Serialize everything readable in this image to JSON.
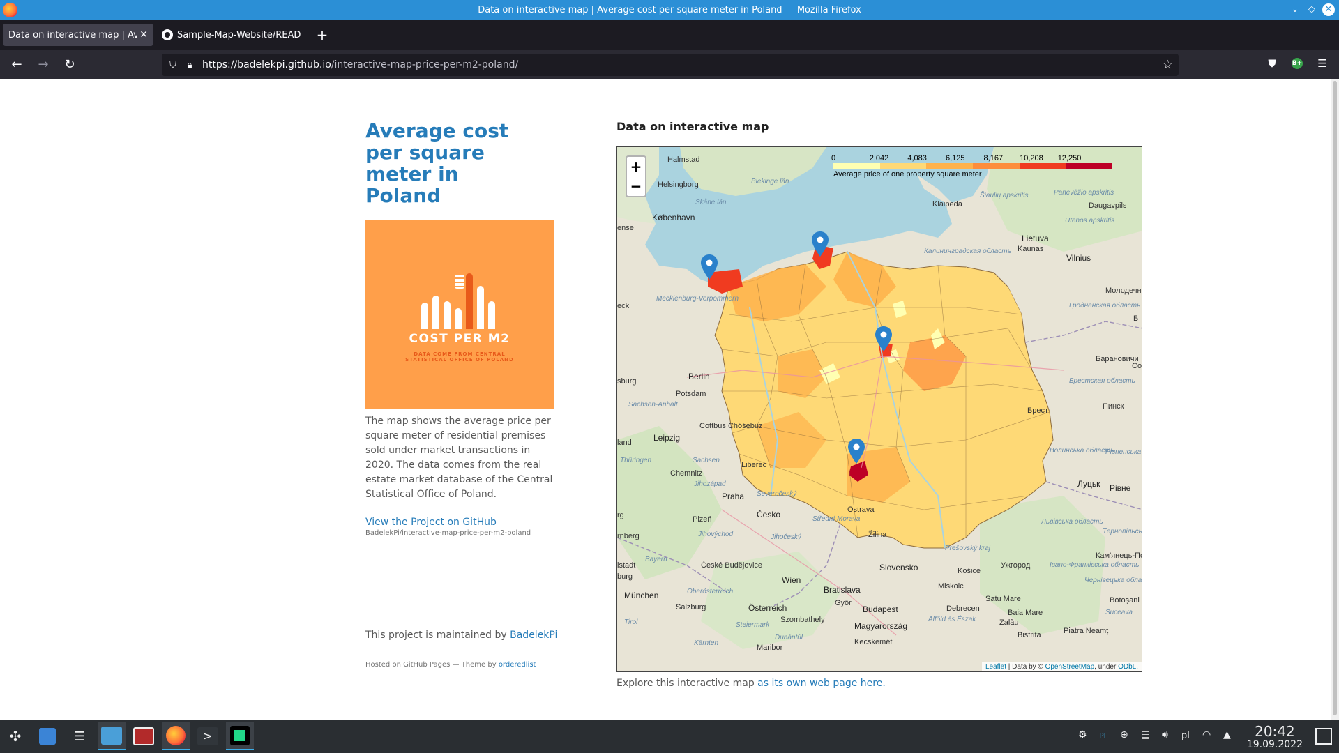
{
  "window": {
    "title": "Data on interactive map | Average cost per square meter in Poland — Mozilla Firefox",
    "controls": [
      "minimize-icon",
      "maximize-icon",
      "close-icon"
    ]
  },
  "tabs": [
    {
      "label": "Data on interactive map | Average cost per square meter in Poland",
      "active": true
    },
    {
      "label": "Sample-Map-Website/README.md",
      "active": false
    }
  ],
  "urlbar": {
    "host": "https://badelekpi.github.io",
    "path": "/interactive-map-price-per-m2-poland/"
  },
  "extension_badge": "B+",
  "sidebar": {
    "title": "Average cost per square meter in Poland",
    "logo_title": "COST PER M2",
    "logo_sub_1": "DATA COME FROM CENTRAL",
    "logo_sub_2": "STATISTICAL OFFICE OF POLAND",
    "description": "The map shows the average price per square meter of residential premises sold under market transactions in 2020. The data comes from the real estate market database of the Central Statistical Office of Poland.",
    "github_link": "View the Project on GitHub",
    "github_repo": "BadelekPi/interactive-map-price-per-m2-poland",
    "maintained_prefix": "This project is maintained by ",
    "maintainer": "BadelekPi",
    "hosted_prefix": "Hosted on GitHub Pages — Theme by ",
    "theme": "orderedlist"
  },
  "map": {
    "heading": "Data on interactive map",
    "zoom_in": "+",
    "zoom_out": "−",
    "legend": {
      "ticks": [
        "0",
        "2,042",
        "4,083",
        "6,125",
        "8,167",
        "10,208",
        "12,250"
      ],
      "colors": [
        "#ffffb2",
        "#fed976",
        "#feb24c",
        "#fd8d3c",
        "#f03b20",
        "#bd0026"
      ],
      "caption": "Average price of one property square meter"
    },
    "attribution": {
      "leaflet": "Leaflet",
      "mid": " | Data by © ",
      "osm": "OpenStreetMap",
      "under": ", under ",
      "odbl": "ODbL."
    },
    "labels": {
      "halmstad": "Halmstad",
      "helsingborg": "Helsingborg",
      "kobenhavn": "København",
      "skane": "Skåne län",
      "blekinge": "Blekinge län",
      "klaipeda": "Klaipėda",
      "siauliu": "Šiaulių apskritis",
      "panevezio": "Panevėžio apskritis",
      "daugavpils": "Daugavpils",
      "utenos": "Utenos apskritis",
      "lietuva": "Lietuva",
      "kaunas": "Kaunas",
      "vilnius": "Vilnius",
      "kaliningrad": "Калининградская область",
      "molodechno": "Молодечно",
      "grodno": "Гродненская область",
      "baranovichi": "Барановичи",
      "brest_obl": "Брестская область",
      "brest": "Брест",
      "pinsk": "Пинск",
      "mecklenburg": "Mecklenburg-Vorpommern",
      "berlin": "Berlin",
      "potsdam": "Potsdam",
      "sachsen_anhalt": "Sachsen-Anhalt",
      "cottbus": "Cottbus Chóśebuz",
      "leipzig": "Leipzig",
      "thuringen": "Thüringen",
      "sachsen": "Sachsen",
      "chemnitz": "Chemnitz",
      "liberec": "Liberec",
      "praha": "Praha",
      "cesko": "Česko",
      "plzen": "Plzeň",
      "severocesky": "Severočeský",
      "strední_morava": "Střední Morava",
      "jihocesky": "Jihočeský",
      "plzensky": "Jihozápad",
      "jihovychod": "Jihovýchod",
      "ceske_budejovice": "České Budějovice",
      "ostrava": "Ostrava",
      "zilina": "Žilina",
      "slovensko": "Slovensko",
      "presovsky": "Prešovský kraj",
      "kosice": "Košice",
      "miskolc": "Miskolc",
      "uzhgorod": "Ужгород",
      "lutsk": "Луцьк",
      "rivne": "Рівне",
      "volynska": "Волинська область",
      "rivnenska": "Рівненська область",
      "lvivska": "Львівська область",
      "ternopil": "Тернопільська область",
      "khmelnytsk": "Кам'янець-Подільський",
      "ivano": "Івано-Франківська область",
      "chernivtsi": "Чернівецька область",
      "botosani": "Botoșani",
      "suceava": "Suceava",
      "satu_mare": "Satu Mare",
      "baia_mare": "Baia Mare",
      "zalau": "Zalău",
      "bistrita": "Bistrița",
      "piatra": "Piatra Neamț",
      "debrecen": "Debrecen",
      "budapest": "Budapest",
      "magyarorszag": "Magyarország",
      "alfold": "Alföld és Észak",
      "kecskemet": "Kecskemét",
      "gyor": "Győr",
      "szombathely": "Szombathely",
      "bratislava": "Bratislava",
      "wien": "Wien",
      "osterreich": "Österreich",
      "salzburg": "Salzburg",
      "munchen": "München",
      "oberosterreich": "Oberösterreich",
      "steiermark": "Steiermark",
      "karnten": "Kärnten",
      "tirol": "Tirol",
      "bayern": "Bayern",
      "nurnberg": "rnberg",
      "burg": "burg",
      "istadt": "lstadt",
      "rg": "rg",
      "ense": "ense",
      "eck": "eck",
      "sburg": "sburg",
      "land": "land",
      "maribor": "Maribor",
      "dunantul": "Dunántúl",
      "b": "Б",
      "co": "Co"
    }
  },
  "explore": {
    "prefix": "Explore this interactive map ",
    "link": "as its own web page here."
  },
  "taskbar": {
    "keyboard": "PL",
    "lang": "pl",
    "time": "20:42",
    "date": "19.09.2022"
  }
}
